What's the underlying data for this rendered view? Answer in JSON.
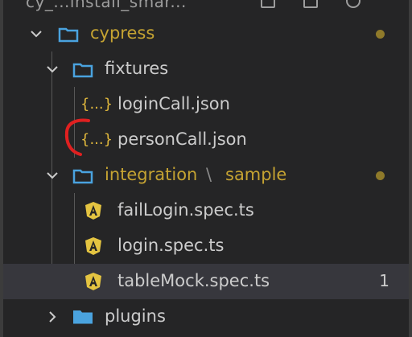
{
  "topbar": {
    "title": "cy_...install_smar..."
  },
  "tree": {
    "cypress": {
      "label": "cypress"
    },
    "fixtures": {
      "label": "fixtures"
    },
    "loginCall": {
      "label": "loginCall.json",
      "icon": "{...}"
    },
    "personCall": {
      "label": "personCall.json",
      "icon": "{...}"
    },
    "integration": {
      "label": "integration",
      "sep": "\\",
      "sub": "sample"
    },
    "failLogin": {
      "label": "failLogin.spec.ts"
    },
    "login": {
      "label": "login.spec.ts"
    },
    "tableMock": {
      "label": "tableMock.spec.ts",
      "badge": "1"
    },
    "plugins": {
      "label": "plugins"
    }
  },
  "colors": {
    "background": "#252526",
    "selected": "#37373d",
    "modified": "#c5a332",
    "folder": "#4aa3df",
    "json": "#e2b93d",
    "angular": "#e4c441",
    "annotation": "#e02020"
  }
}
